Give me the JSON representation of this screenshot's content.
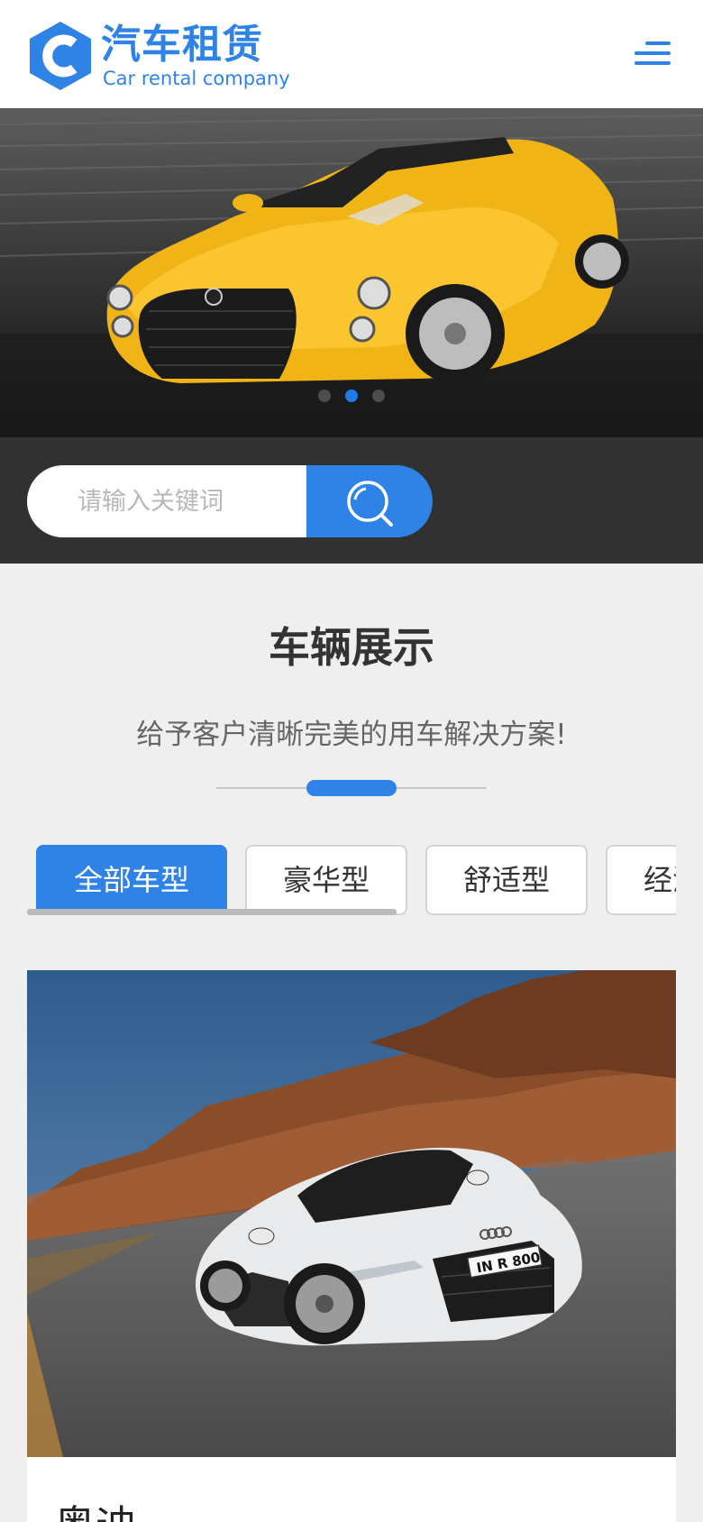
{
  "header": {
    "logo_title": "汽车租赁",
    "logo_subtitle": "Car rental company",
    "logo_letter": "C"
  },
  "banner": {
    "slide_count": 3,
    "active_slide": 2
  },
  "search": {
    "placeholder": "请输入关键词"
  },
  "section": {
    "title": "车辆展示",
    "subtitle": "给予客户清晰完美的用车解决方案!"
  },
  "tabs": [
    {
      "label": "全部车型",
      "active": true
    },
    {
      "label": "豪华型",
      "active": false
    },
    {
      "label": "舒适型",
      "active": false
    },
    {
      "label": "经济型",
      "active": false
    }
  ],
  "cars": [
    {
      "name": "奥迪",
      "plate": "IN R 800"
    }
  ],
  "colors": {
    "accent": "#2f83e6",
    "search_bar_bg": "#313131",
    "page_bg": "#efefef"
  }
}
